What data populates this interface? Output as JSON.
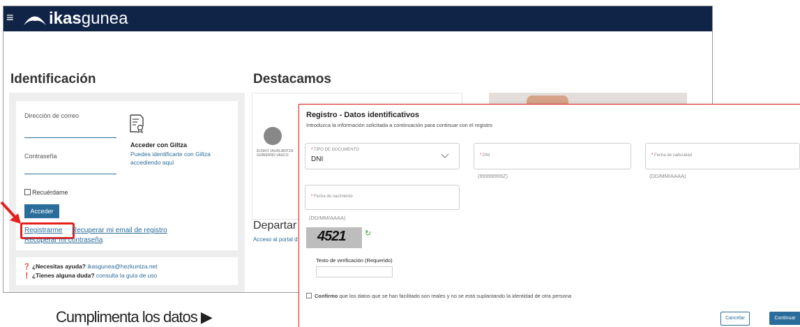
{
  "app": {
    "logo_bold": "ikas",
    "logo_light": "gunea",
    "menu_icon": "menu-icon"
  },
  "identification": {
    "title": "Identificación",
    "email_label": "Dirección de correo",
    "password_label": "Contraseña",
    "gitza_title": "Acceder con Giltza",
    "gitza_text": "Puedes identificarte con Giltza accediendo aquí",
    "remember_label": "Recuérdame",
    "login_button": "Acceder",
    "register_link": "Registrarme",
    "recover_email_link": "Recuperar mi email de registro",
    "recover_password_link": "Recuperar mi contraseña",
    "help_question": "¿Necesitas ayuda?",
    "help_email": "ikasgunea@hezkuntza.net",
    "doubt_question": "¿Tienes alguna duda?",
    "doubt_link": "consulta la guía de uso"
  },
  "highlights": {
    "title": "Destacamos",
    "emblem_text_1": "EUSKO JAURLARITZA",
    "emblem_text_2": "GOBIERNO VASCO",
    "department_title": "Departar",
    "department_link": "Acceso al portal d"
  },
  "dialog": {
    "title": "Registro - Datos identificativos",
    "subtitle": "Introduzca la información solicitada a continuación para continuar con el registro",
    "doc_type_label": "TIPO DE DOCUMENTO",
    "doc_type_value": "DNI",
    "dni_label": "DNI",
    "dni_hint": "(99999999Z)",
    "expiry_label": "Fecha de caducidad",
    "expiry_hint": "(DD/MM/AAAA)",
    "birth_label": "Fecha de nacimiento",
    "birth_hint": "(DD/MM/AAAA)",
    "captcha_text": "4521",
    "verification_label": "Texto de verificación (Requerido)",
    "confirm_bold": "Confirmo",
    "confirm_text": "que los datos que se han facilitado son reales y no se está suplantando la identidad de otra persona",
    "cancel_button": "Cancelar",
    "continue_button": "Continuar"
  },
  "caption": "Cumplimenta los datos ▶",
  "colors": {
    "topbar": "#0f2447",
    "accent": "#2a6d9a",
    "highlight_red": "#e5201c"
  }
}
